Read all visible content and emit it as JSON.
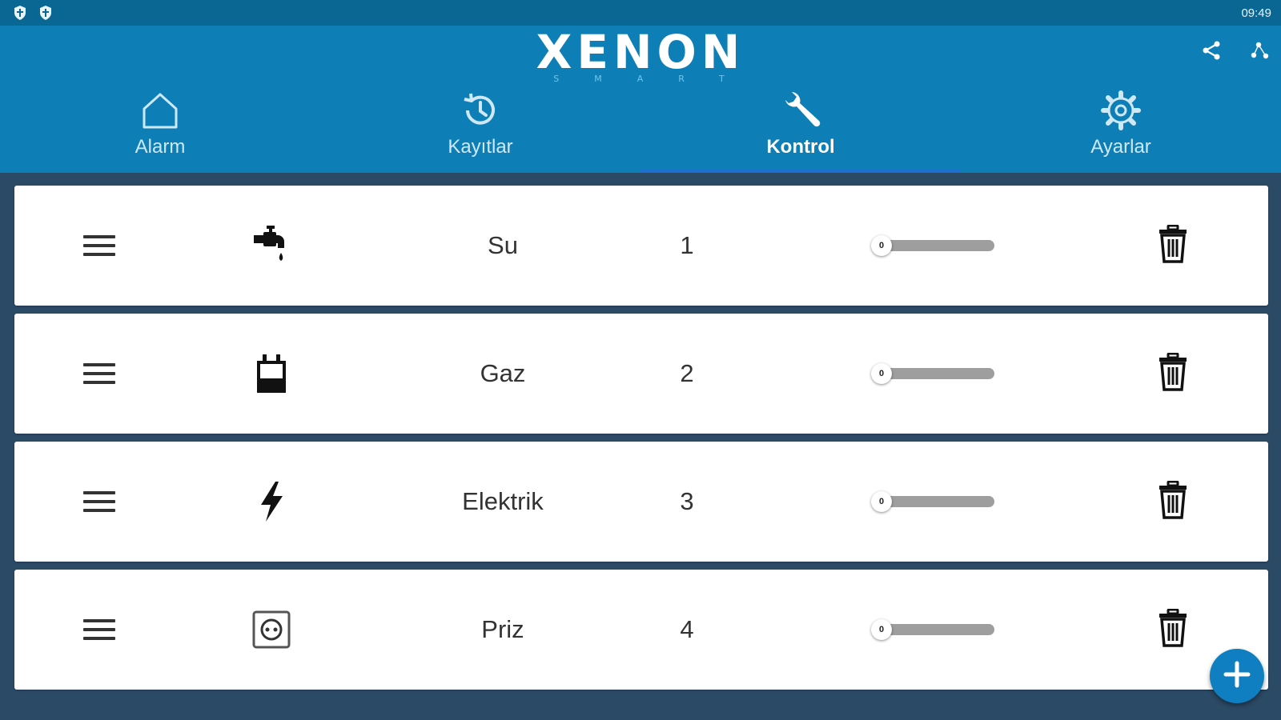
{
  "status_bar": {
    "time": "09:49",
    "left_icons": [
      "shield-icon",
      "shield-icon"
    ]
  },
  "header": {
    "logo_text": "XENON",
    "logo_subtext": "SMART",
    "actions": [
      "share-icon",
      "network-icon"
    ]
  },
  "tabs": [
    {
      "label": "Alarm",
      "icon": "home-icon",
      "active": false
    },
    {
      "label": "Kayıtlar",
      "icon": "history-icon",
      "active": false
    },
    {
      "label": "Kontrol",
      "icon": "wrench-icon",
      "active": true
    },
    {
      "label": "Ayarlar",
      "icon": "gear-icon",
      "active": false
    }
  ],
  "rows": [
    {
      "name": "Su",
      "number": "1",
      "icon": "water-tap-icon",
      "slider_value": "0",
      "slider_fraction": 0
    },
    {
      "name": "Gaz",
      "number": "2",
      "icon": "gas-meter-icon",
      "slider_value": "0",
      "slider_fraction": 0
    },
    {
      "name": "Elektrik",
      "number": "3",
      "icon": "lightning-icon",
      "slider_value": "0",
      "slider_fraction": 0
    },
    {
      "name": "Priz",
      "number": "4",
      "icon": "power-outlet-icon",
      "slider_value": "0",
      "slider_fraction": 0
    }
  ],
  "fab": {
    "icon": "plus-icon"
  },
  "colors": {
    "status_bar": "#0a6692",
    "header": "#0e7fb6",
    "active_indicator": "#1b6fd0",
    "background": "#2b4a66",
    "fab": "#0f7fc2"
  }
}
